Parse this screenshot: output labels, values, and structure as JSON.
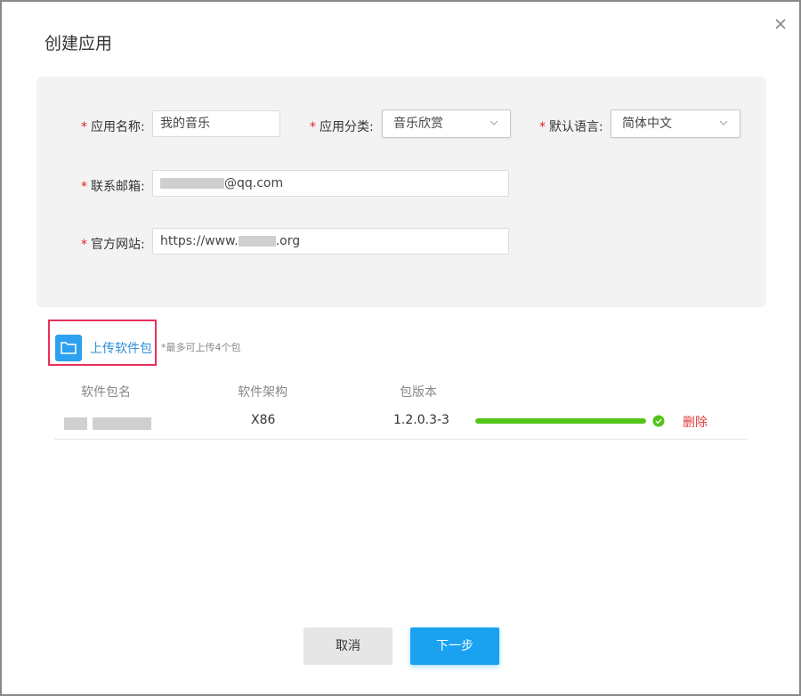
{
  "dialog": {
    "title": "创建应用",
    "close_icon": "close-icon"
  },
  "form": {
    "app_name": {
      "label": "应用名称:",
      "value": "我的音乐"
    },
    "category": {
      "label": "应用分类:",
      "value": "音乐欣赏"
    },
    "language": {
      "label": "默认语言:",
      "value": "简体中文"
    },
    "email": {
      "label": "联系邮箱:",
      "value_suffix": "@qq.com"
    },
    "website": {
      "label": "官方网站:",
      "value_prefix": "https://www.",
      "value_suffix": ".org"
    }
  },
  "upload": {
    "button_label": "上传软件包",
    "hint": "*最多可上传4个包"
  },
  "table": {
    "headers": [
      "软件包名",
      "软件架构",
      "包版本"
    ],
    "rows": [
      {
        "arch": "X86",
        "version": "1.2.0.3-3",
        "progress": 1.0,
        "delete_label": "删除"
      }
    ]
  },
  "footer": {
    "cancel_label": "取消",
    "next_label": "下一步"
  },
  "colors": {
    "primary": "#1aa2f0",
    "success": "#52c41a",
    "danger": "#e03a3a",
    "highlight_border": "#e8305a"
  }
}
